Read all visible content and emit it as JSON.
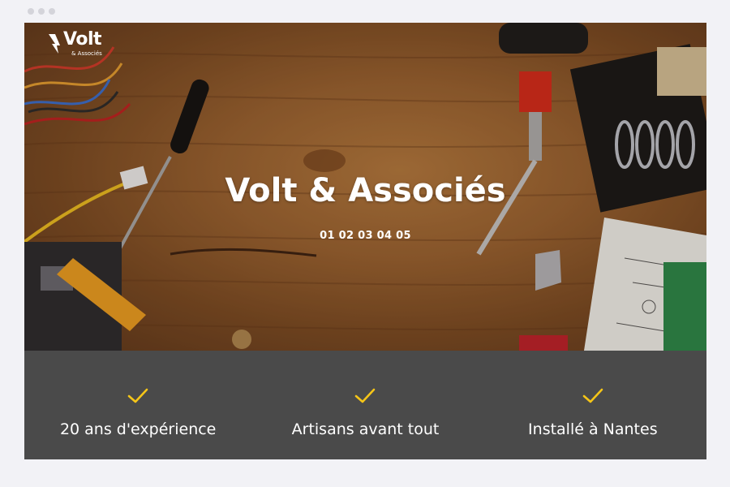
{
  "brand": {
    "logo_word": "Volt",
    "logo_sub": "& Associés",
    "accent_color": "#f5c518"
  },
  "hero": {
    "title": "Volt & Associés",
    "phone": "01 02 03 04 05"
  },
  "features": [
    {
      "icon": "check-icon",
      "label": "20 ans d'expérience"
    },
    {
      "icon": "check-icon",
      "label": "Artisans avant tout"
    },
    {
      "icon": "check-icon",
      "label": "Installé à Nantes"
    }
  ]
}
